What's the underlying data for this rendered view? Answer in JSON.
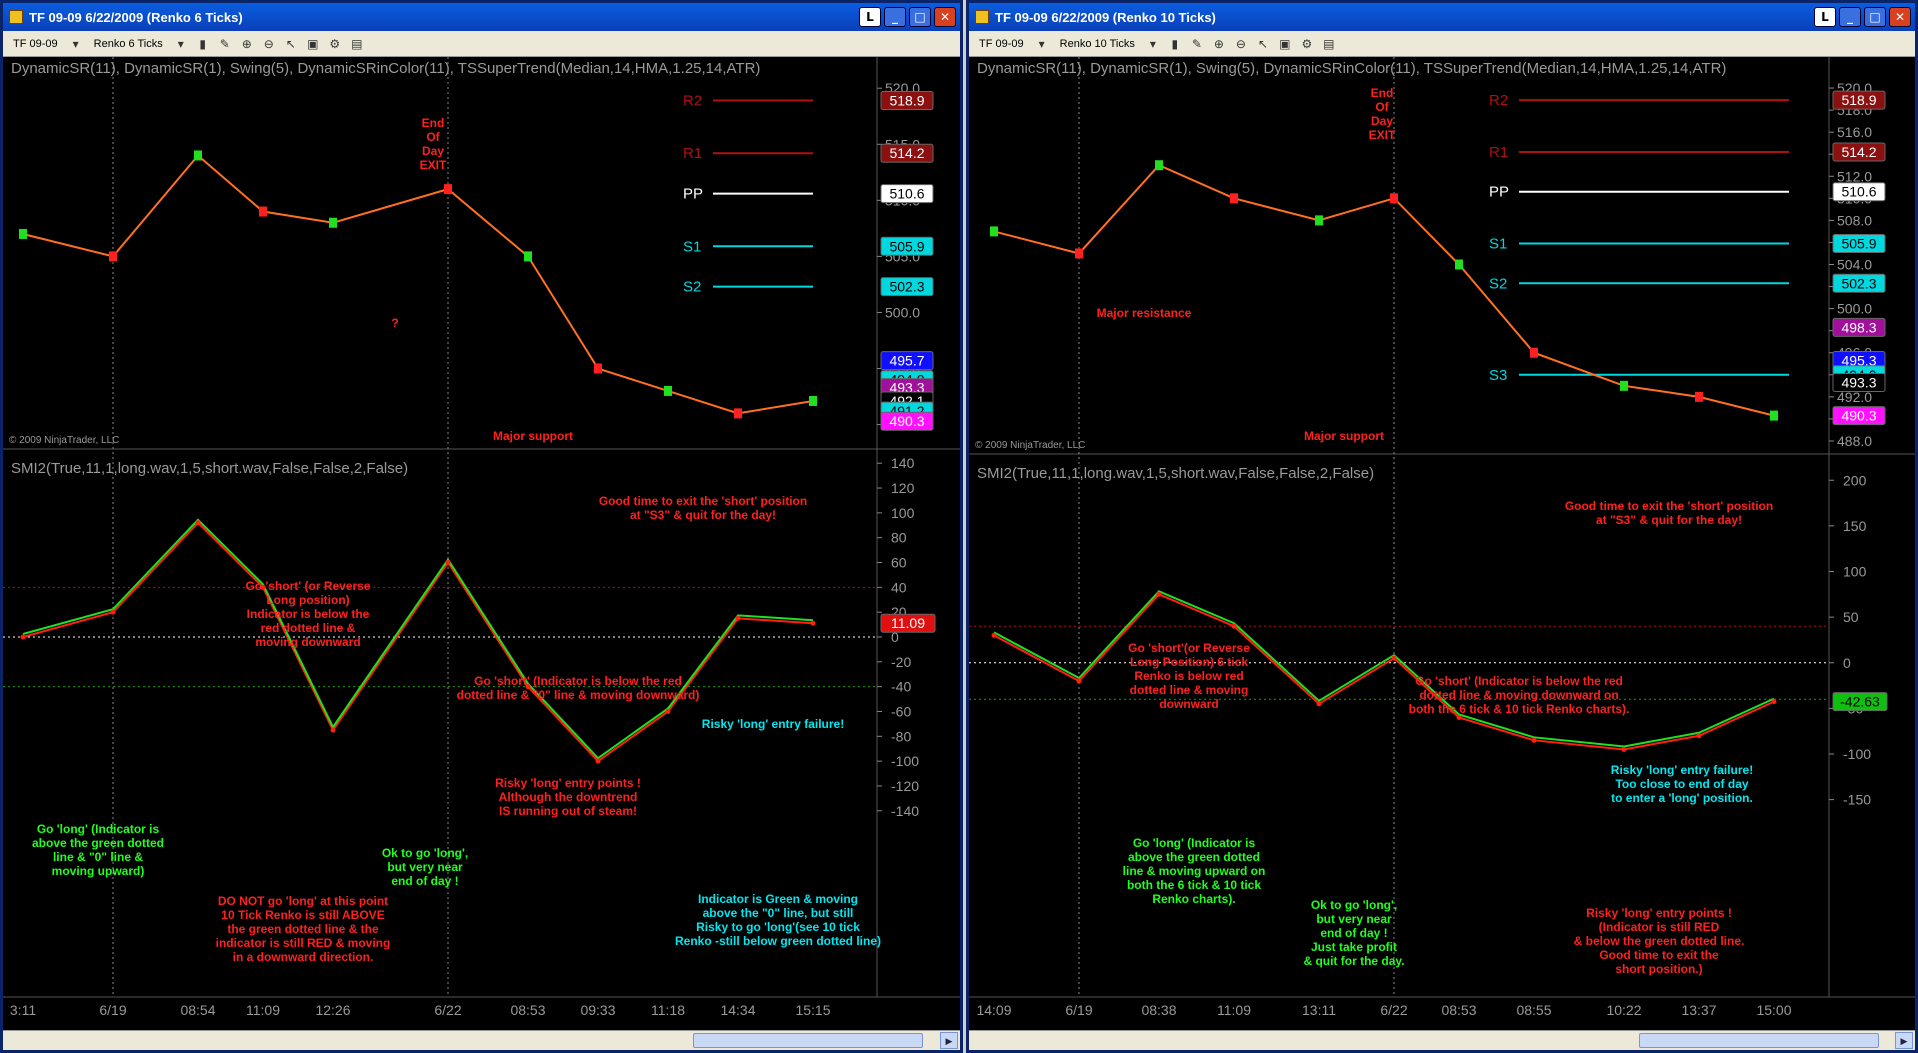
{
  "windows": [
    {
      "id": "w1",
      "title": "TF 09-09  6/22/2009 (Renko 6 Ticks)",
      "instrument": "TF 09-09",
      "period": "Renko 6 Ticks",
      "indicator_label": "DynamicSR(11),  DynamicSR(1),  Swing(5),  DynamicSRinColor(11),  TSSuperTrend(Median,14,HMA,1.25,14,ATR)",
      "osc_label": "SMI2(True,11,1,long.wav,1,5,short.wav,False,False,2,False)",
      "copyright": "© 2009 NinjaTrader, LLC",
      "price_ticks": [
        "520.0",
        "515.0",
        "510.0",
        "505.0",
        "500.0",
        "495.0",
        "490.0"
      ],
      "osc_ticks": [
        "140",
        "120",
        "100",
        "80",
        "60",
        "40",
        "20",
        "0",
        "-20",
        "-40",
        "-60",
        "-80",
        "-100",
        "-120",
        "-140"
      ],
      "time_labels": [
        "3:11",
        "6/19",
        "08:54",
        "11:09",
        "12:26",
        "6/22",
        "08:53",
        "09:33",
        "11:18",
        "14:34",
        "15:15"
      ],
      "pivot_labels": [
        "R2",
        "R1",
        "PP",
        "S1",
        "S2"
      ],
      "price_tags": [
        {
          "text": "518.9",
          "bg": "#8b1010",
          "fg": "#ffffff"
        },
        {
          "text": "514.2",
          "bg": "#8b1010",
          "fg": "#ffffff"
        },
        {
          "text": "510.6",
          "bg": "#ffffff",
          "fg": "#000000"
        },
        {
          "text": "505.9",
          "bg": "#00d8e0",
          "fg": "#000000"
        },
        {
          "text": "502.3",
          "bg": "#00d8e0",
          "fg": "#000000"
        },
        {
          "text": "495.7",
          "bg": "#1010ff",
          "fg": "#ffffff"
        },
        {
          "text": "494.0",
          "bg": "#00d8e0",
          "fg": "#000000"
        },
        {
          "text": "493.3",
          "bg": "#a0109a",
          "fg": "#ffffff"
        },
        {
          "text": "492.1",
          "bg": "#000000",
          "fg": "#ffffff"
        },
        {
          "text": "491.2",
          "bg": "#00d8e0",
          "fg": "#000000"
        },
        {
          "text": "490.3",
          "bg": "#ff10ff",
          "fg": "#ffffff"
        }
      ],
      "osc_tag": {
        "text": "11.09",
        "bg": "#e01010",
        "fg": "#ffffff"
      },
      "notes": [
        {
          "text": "End\nOf\nDay\nEXIT",
          "color": "#ff2020"
        },
        {
          "text": "?",
          "color": "#ff2020"
        },
        {
          "text": "Major support",
          "color": "#ff2020"
        },
        {
          "text": "Good time to exit the 'short' position\nat \"S3\" & quit for the day!",
          "color": "#ff2020"
        },
        {
          "text": "Go 'short' (or Reverse\nLong position)\nIndicator is below the\nred dotted line &\nmoving downward",
          "color": "#ff2020"
        },
        {
          "text": "Go 'short' (Indicator is below the red\ndotted line & \"0\" line & moving downward)",
          "color": "#ff2020"
        },
        {
          "text": "Risky 'long' entry failure!",
          "color": "#00e8f0"
        },
        {
          "text": "Risky 'long' entry points !\nAlthough the downtrend\nIS running out of steam!",
          "color": "#ff2020"
        },
        {
          "text": "Go 'long' (Indicator is\nabove the green dotted\nline & \"0\" line &\nmoving upward)",
          "color": "#20ff20"
        },
        {
          "text": "Ok to go 'long',\nbut very near\nend of day !",
          "color": "#20ff20"
        },
        {
          "text": "DO NOT go 'long' at this point\n10 Tick Renko is still ABOVE\nthe green dotted line & the\nindicator is still RED & moving\nin a downward direction.",
          "color": "#ff2020"
        },
        {
          "text": "Indicator is Green & moving\nabove the \"0\" line, but still\nRisky to go 'long'(see 10 tick\nRenko -still below green dotted line)",
          "color": "#00e8f0"
        }
      ]
    },
    {
      "id": "w2",
      "title": "TF 09-09  6/22/2009 (Renko 10 Ticks)",
      "instrument": "TF 09-09",
      "period": "Renko 10 Ticks",
      "indicator_label": "DynamicSR(11),  DynamicSR(1),  Swing(5),  DynamicSRinColor(11),  TSSuperTrend(Median,14,HMA,1.25,14,ATR)",
      "osc_label": "SMI2(True,11,1,long.wav,1,5,short.wav,False,False,2,False)",
      "copyright": "© 2009 NinjaTrader, LLC",
      "price_ticks": [
        "520.0",
        "518.0",
        "516.0",
        "514.0",
        "512.0",
        "510.0",
        "508.0",
        "506.0",
        "504.0",
        "502.0",
        "500.0",
        "498.0",
        "496.0",
        "494.0",
        "492.0",
        "490.0",
        "488.0"
      ],
      "osc_ticks": [
        "200",
        "150",
        "100",
        "50",
        "0",
        "-50",
        "-100",
        "-150"
      ],
      "time_labels": [
        "14:09",
        "6/19",
        "08:38",
        "11:09",
        "13:11",
        "6/22",
        "08:53",
        "08:55",
        "10:22",
        "13:37",
        "15:00"
      ],
      "pivot_labels": [
        "R2",
        "R1",
        "PP",
        "S1",
        "S2",
        "S3"
      ],
      "price_tags": [
        {
          "text": "518.9",
          "bg": "#8b1010",
          "fg": "#ffffff"
        },
        {
          "text": "514.2",
          "bg": "#8b1010",
          "fg": "#ffffff"
        },
        {
          "text": "510.6",
          "bg": "#ffffff",
          "fg": "#000000"
        },
        {
          "text": "505.9",
          "bg": "#00d8e0",
          "fg": "#000000"
        },
        {
          "text": "502.3",
          "bg": "#00d8e0",
          "fg": "#000000"
        },
        {
          "text": "498.3",
          "bg": "#a0109a",
          "fg": "#ffffff"
        },
        {
          "text": "495.3",
          "bg": "#1010ff",
          "fg": "#ffffff"
        },
        {
          "text": "494.0",
          "bg": "#00d8e0",
          "fg": "#000000"
        },
        {
          "text": "493.3",
          "bg": "#000000",
          "fg": "#ffffff"
        },
        {
          "text": "490.3",
          "bg": "#ff10ff",
          "fg": "#ffffff"
        }
      ],
      "osc_tag": {
        "text": "-42.63",
        "bg": "#10c010",
        "fg": "#000000"
      },
      "notes": [
        {
          "text": "End\nOf\nDay\nEXIT",
          "color": "#ff2020"
        },
        {
          "text": "Major resistance",
          "color": "#ff2020"
        },
        {
          "text": "Major support",
          "color": "#ff2020"
        },
        {
          "text": "Good time to exit the 'short' position\nat \"S3\" & quit for the day!",
          "color": "#ff2020"
        },
        {
          "text": "Go 'short'(or Reverse\nLong Position) 6 tick\nRenko is below red\ndotted line & moving\ndownward",
          "color": "#ff2020"
        },
        {
          "text": "Go 'short' (Indicator is below the red\ndotted line & moving downward on\nboth the 6 tick & 10 tick Renko charts).",
          "color": "#ff2020"
        },
        {
          "text": "Risky 'long' entry failure!\nToo close to end of day\nto enter a 'long' position.",
          "color": "#00e8f0"
        },
        {
          "text": "Go 'long' (Indicator is\nabove the green dotted\nline & moving upward on\nboth the 6 tick & 10 tick\nRenko charts).",
          "color": "#20ff20"
        },
        {
          "text": "Ok to go 'long',\nbut very near\nend of day !\nJust take profit\n& quit for the day.",
          "color": "#20ff20"
        },
        {
          "text": "Risky 'long' entry points !\n(Indicator is still RED\n& below the green dotted line.\nGood time to exit the\nshort position.)",
          "color": "#ff2020"
        }
      ]
    }
  ],
  "chart_data": [
    {
      "type": "line",
      "title": "TF 09-09  6/22/2009 (Renko 6 Ticks)",
      "x": [
        "3:11",
        "6/19",
        "08:54",
        "11:09",
        "12:26",
        "6/22",
        "08:53",
        "09:33",
        "11:18",
        "14:34",
        "15:15"
      ],
      "series": [
        {
          "name": "",
          "values": [
            507,
            505,
            514,
            509,
            508,
            511,
            505,
            495,
            493,
            491,
            492.1
          ]
        }
      ],
      "ylim": [
        488,
        521
      ],
      "pivots": {
        "R2": 518.9,
        "R1": 514.2,
        "PP": 510.6,
        "S1": 505.9,
        "S2": 502.3
      },
      "oscillator": {
        "x": [
          "3:11",
          "6/19",
          "08:54",
          "11:09",
          "12:26",
          "6/22",
          "08:53",
          "09:33",
          "11:18",
          "14:34",
          "15:15"
        ],
        "values": [
          0,
          20,
          92,
          40,
          -75,
          60,
          -40,
          -100,
          -60,
          15,
          11.09
        ],
        "ylim": [
          -145,
          145
        ],
        "upper_level": 40,
        "lower_level": -40
      }
    },
    {
      "type": "line",
      "title": "TF 09-09  6/22/2009 (Renko 10 Ticks)",
      "x": [
        "14:09",
        "6/19",
        "08:38",
        "11:09",
        "13:11",
        "6/22",
        "08:53",
        "08:55",
        "10:22",
        "13:37",
        "15:00"
      ],
      "series": [
        {
          "name": "",
          "values": [
            507,
            505,
            513,
            510,
            508,
            510,
            504,
            496,
            493,
            492,
            490.3
          ]
        }
      ],
      "ylim": [
        487,
        521
      ],
      "pivots": {
        "R2": 518.9,
        "R1": 514.2,
        "PP": 510.6,
        "S1": 505.9,
        "S2": 502.3,
        "S3": 494.0
      },
      "oscillator": {
        "x": [
          "14:09",
          "6/19",
          "08:38",
          "11:09",
          "13:11",
          "6/22",
          "08:53",
          "08:55",
          "10:22",
          "13:37",
          "15:00"
        ],
        "values": [
          30,
          -20,
          75,
          40,
          -45,
          5,
          -60,
          -85,
          -95,
          -80,
          -42.63
        ],
        "ylim": [
          -180,
          220
        ],
        "upper_level": 40,
        "lower_level": -40
      }
    }
  ]
}
